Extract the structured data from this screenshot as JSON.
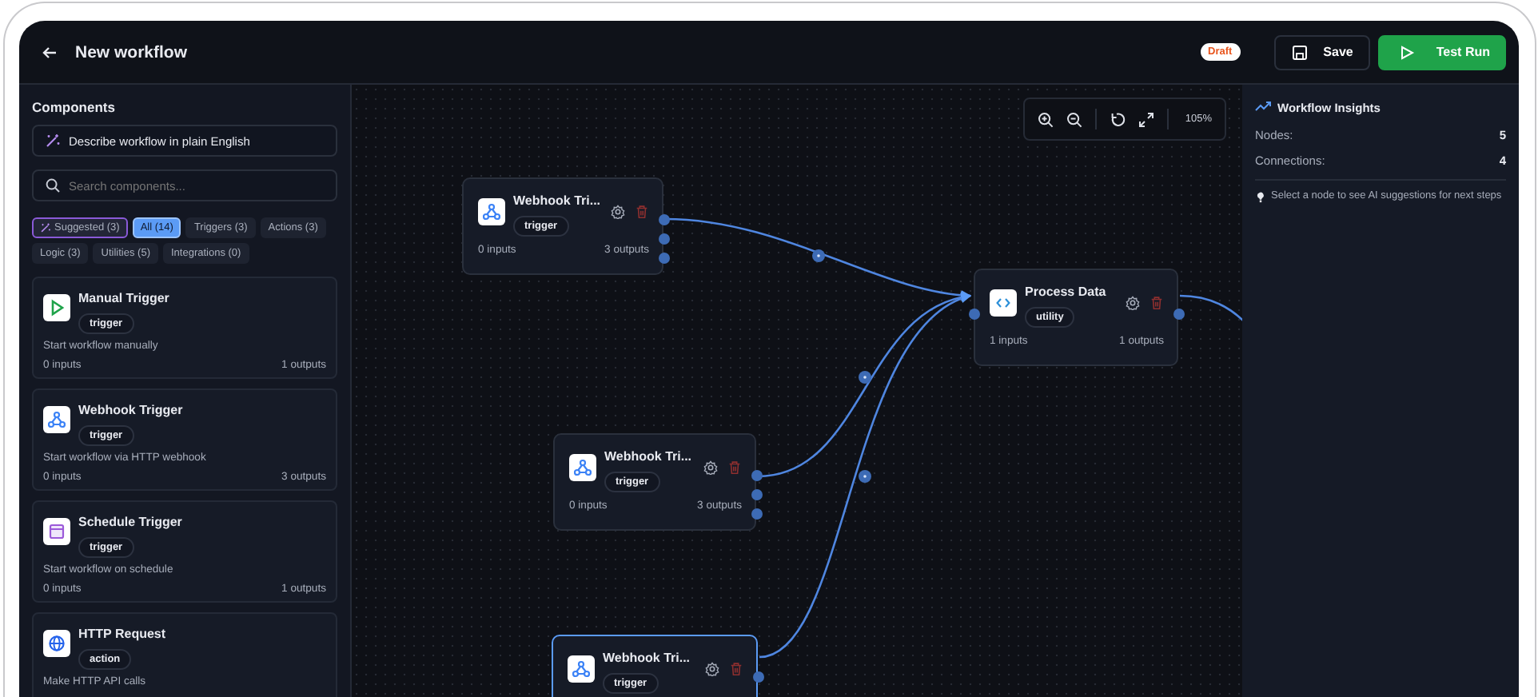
{
  "header": {
    "title": "New workflow",
    "status": "Draft",
    "buttons": [
      {
        "label": "Save",
        "kind": "secondary"
      },
      {
        "label": "Test Run",
        "kind": "primary"
      }
    ]
  },
  "sidebar": {
    "heading": "Components",
    "ai_prompt": "Describe workflow in plain English",
    "search": {
      "placeholder": "Search components..."
    },
    "filters": [
      {
        "label": "Suggested (3)",
        "kind": "ai",
        "selected": false
      },
      {
        "label": "All (14)",
        "kind": "category",
        "selected": true
      },
      {
        "label": "Triggers (3)",
        "kind": "category",
        "selected": false
      },
      {
        "label": "Actions (3)",
        "kind": "category",
        "selected": false
      },
      {
        "label": "Logic (3)",
        "kind": "category",
        "selected": false
      },
      {
        "label": "Utilities (5)",
        "kind": "category",
        "selected": false
      },
      {
        "label": "Integrations (0)",
        "kind": "category",
        "selected": false
      }
    ],
    "components": [
      {
        "name": "Manual Trigger",
        "tag": "trigger",
        "description": "Start workflow manually",
        "inputs": "0 inputs",
        "outputs": "1 outputs"
      },
      {
        "name": "Webhook Trigger",
        "tag": "trigger",
        "description": "Start workflow via HTTP webhook",
        "inputs": "0 inputs",
        "outputs": "3 outputs"
      },
      {
        "name": "Schedule Trigger",
        "tag": "trigger",
        "description": "Start workflow on schedule",
        "inputs": "0 inputs",
        "outputs": "1 outputs"
      },
      {
        "name": "HTTP Request",
        "tag": "action",
        "description": "Make HTTP API calls"
      }
    ]
  },
  "canvas": {
    "zoom": "105%",
    "nodes": [
      {
        "title": "Webhook Tri...",
        "tag": "trigger",
        "inputs": "0 inputs",
        "outputs": "3 outputs",
        "selected": false
      },
      {
        "title": "Process Data",
        "tag": "utility",
        "inputs": "1 inputs",
        "outputs": "1 outputs",
        "selected": false
      },
      {
        "title": "Webhook Tri...",
        "tag": "trigger",
        "inputs": "0 inputs",
        "outputs": "3 outputs",
        "selected": false
      },
      {
        "title": "Webhook Tri...",
        "tag": "trigger",
        "selected": true
      }
    ]
  },
  "insights": {
    "title": "Workflow Insights",
    "stats": [
      {
        "label": "Nodes:",
        "value": "5"
      },
      {
        "label": "Connections:",
        "value": "4"
      }
    ],
    "hint": "Select a node to see AI suggestions for next steps"
  }
}
